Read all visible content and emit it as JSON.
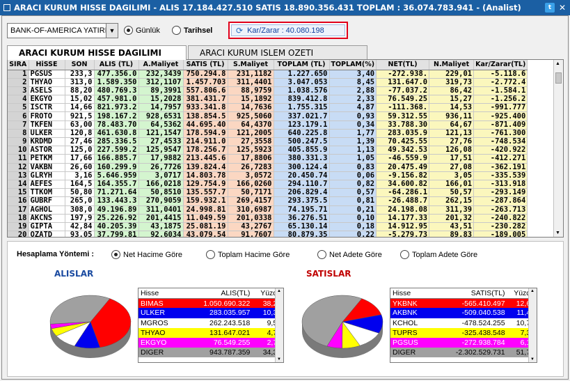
{
  "window": {
    "title": "ARACI KURUM HISSE DAGILIMI - ALIS 17.184.427.510  SATIS 18.890.356.431  TOPLAM : 36.074.783.941 - (Analist)"
  },
  "toolbar": {
    "broker": "BANK-OF-AMERICA YATIRIM",
    "radio_gunluk": "Günlük",
    "radio_tarihsel": "Tarihsel",
    "karzarar": "Kar/Zarar : 40.080.198"
  },
  "tabs": [
    "ARACI KURUM HISSE DAGILIMI",
    "ARACI KURUM ISLEM OZETI"
  ],
  "grid": {
    "headers": [
      "SIRA",
      "HiSSE",
      "SON",
      "ALIS (TL)",
      "A.Maliyet",
      "SATIS (TL)",
      "S.Maliyet",
      "TOPLAM (TL)",
      "TOPLAM(%)",
      "NET(TL)",
      "N.Maliyet",
      "Kar/Zarar(TL)"
    ],
    "rows": [
      [
        "1",
        "PGSUS",
        "233,3",
        "477.356.0",
        "232,3439",
        "750.294.8",
        "231,1182",
        "1.227.650",
        "3,40",
        "-272.938.",
        "229,01",
        "-5.118.6"
      ],
      [
        "2",
        "THYAO",
        "313,0",
        "1.589.350",
        "312,1107",
        "1.457.703",
        "311,4401",
        "3.047.053",
        "8,45",
        "131.647.0",
        "319,73",
        "-2.772.4"
      ],
      [
        "3",
        "ASELS",
        "88,20",
        "480.769.3",
        "89,3991",
        "557.806.6",
        "88,9759",
        "1.038.576",
        "2,88",
        "-77.037.2",
        "86,42",
        "-1.584.1"
      ],
      [
        "4",
        "EKGYO",
        "15,02",
        "457.981.0",
        "15,2028",
        "381.431.7",
        "15,1892",
        "839.412.8",
        "2,33",
        "76.549.25",
        "15,27",
        "-1.256.2"
      ],
      [
        "5",
        "ISCTR",
        "14,66",
        "821.973.2",
        "14,7957",
        "933.341.8",
        "14,7636",
        "1.755.315",
        "4,87",
        "-111.368.",
        "14,53",
        "-991.777"
      ],
      [
        "6",
        "FROTO",
        "921,5",
        "198.167.2",
        "928,6531",
        "138.854.5",
        "925,5060",
        "337.021.7",
        "0,93",
        "59.312.55",
        "936,11",
        "-925.400"
      ],
      [
        "7",
        "TKFEN",
        "63,00",
        "78.483.70",
        "64,5362",
        "44.695.40",
        "64,4370",
        "123.179.1",
        "0,34",
        "33.788.30",
        "64,67",
        "-871.409"
      ],
      [
        "8",
        "ULKER",
        "120,8",
        "461.630.8",
        "121,1547",
        "178.594.9",
        "121,2005",
        "640.225.8",
        "1,77",
        "283.035.9",
        "121,13",
        "-761.300"
      ],
      [
        "9",
        "KRDMD",
        "27,46",
        "285.336.5",
        "27,4533",
        "214.911.0",
        "27,3558",
        "500.247.5",
        "1,39",
        "70.425.55",
        "27,76",
        "-748.534"
      ],
      [
        "10",
        "ASTOR",
        "125,0",
        "227.599.2",
        "125,9547",
        "178.256.7",
        "125,5923",
        "405.855.9",
        "1,13",
        "49.342.53",
        "126,08",
        "-420.922"
      ],
      [
        "11",
        "PETKM",
        "17,66",
        "166.885.7",
        "17,9882",
        "213.445.6",
        "17,8806",
        "380.331.3",
        "1,05",
        "-46.559.9",
        "17,51",
        "-412.271"
      ],
      [
        "12",
        "VAKBN",
        "26,60",
        "160.299.9",
        "26,7726",
        "139.824.4",
        "26,7283",
        "300.124.4",
        "0,83",
        "20.475.49",
        "27,08",
        "-362.191"
      ],
      [
        "13",
        "GLRYH",
        "3,16",
        "5.646.959",
        "3,0717",
        "14.803.78",
        "3,0572",
        "20.450.74",
        "0,06",
        "-9.156.82",
        "3,05",
        "-335.539"
      ],
      [
        "14",
        "AEFES",
        "164,5",
        "164.355.7",
        "166,0218",
        "129.754.9",
        "166,0260",
        "294.110.7",
        "0,82",
        "34.600.82",
        "166,01",
        "-313.918"
      ],
      [
        "15",
        "TTKOM",
        "50,80",
        "71.271.64",
        "50,8510",
        "135.557.7",
        "50,7171",
        "206.829.4",
        "0,57",
        "-64.286.1",
        "50,57",
        "-293.149"
      ],
      [
        "16",
        "GUBRF",
        "265,0",
        "133.443.3",
        "270,9059",
        "159.932.1",
        "269,4157",
        "293.375.5",
        "0,81",
        "-26.488.7",
        "262,15",
        "-287.864"
      ],
      [
        "17",
        "AGHOL",
        "308,0",
        "49.196.89",
        "311,0401",
        "24.998.81",
        "310,6987",
        "74.195.71",
        "0,21",
        "24.198.08",
        "311,39",
        "-263.713"
      ],
      [
        "18",
        "AKCNS",
        "197,9",
        "25.226.92",
        "201,4415",
        "11.049.59",
        "201,0338",
        "36.276.51",
        "0,10",
        "14.177.33",
        "201,32",
        "-240.822"
      ],
      [
        "19",
        "GIPTA",
        "42,84",
        "40.205.39",
        "43,1875",
        "25.081.19",
        "43,2767",
        "65.130.14",
        "0,18",
        "14.912.95",
        "43,51",
        "-230.282"
      ],
      [
        "20",
        "OZATD",
        "93,05",
        "37.799.81",
        "92,6034",
        "43.079.54",
        "91,7607",
        "80.879.35",
        "0,22",
        "-5.279.73",
        "89,83",
        "-189.005"
      ]
    ]
  },
  "hesaplama": {
    "label": "Hesaplama Yöntemi :",
    "options": [
      "Net Hacime Göre",
      "Toplam Hacime Göre",
      "Net Adete Göre",
      "Toplam Adete Göre"
    ]
  },
  "alislar": {
    "title": "ALISLAR",
    "headers": [
      "Hisse",
      "ALIS(TL)",
      "Yüzde"
    ],
    "rows": [
      {
        "name": "BIMAS",
        "value": "1.050.690.322",
        "pct": "38,24",
        "pct_num": 38.24,
        "bg": "#ff0000",
        "fg": "#ffffff"
      },
      {
        "name": "ULKER",
        "value": "283.035.957",
        "pct": "10,30",
        "pct_num": 10.3,
        "bg": "#0000ee",
        "fg": "#ffffff"
      },
      {
        "name": "MGROS",
        "value": "262.243.518",
        "pct": "9,54",
        "pct_num": 9.54,
        "bg": "#ffffff",
        "fg": "#000000"
      },
      {
        "name": "THYAO",
        "value": "131.647.021",
        "pct": "4,79",
        "pct_num": 4.79,
        "bg": "#ffff00",
        "fg": "#000000"
      },
      {
        "name": "EKGYO",
        "value": "76.549.255",
        "pct": "2,79",
        "pct_num": 2.79,
        "bg": "#ff00ff",
        "fg": "#ffffff"
      },
      {
        "name": "DIGER",
        "value": "943.787.359",
        "pct": "34,35",
        "pct_num": 34.35,
        "bg": "#a0a0a0",
        "fg": "#000000"
      }
    ]
  },
  "satislar": {
    "title": "SATISLAR",
    "headers": [
      "Hisse",
      "SATIS(TL)",
      "Yüzde"
    ],
    "rows": [
      {
        "name": "YKBNK",
        "value": "-565.410.497",
        "pct": "12,69",
        "pct_num": 12.69,
        "bg": "#ff0000",
        "fg": "#ffffff"
      },
      {
        "name": "AKBNK",
        "value": "-509.040.538",
        "pct": "11,43",
        "pct_num": 11.43,
        "bg": "#0000ee",
        "fg": "#ffffff"
      },
      {
        "name": "KCHOL",
        "value": "-478.524.255",
        "pct": "10,74",
        "pct_num": 10.74,
        "bg": "#ffffff",
        "fg": "#000000"
      },
      {
        "name": "TUPRS",
        "value": "-325.438.548",
        "pct": "7,31",
        "pct_num": 7.31,
        "bg": "#ffff00",
        "fg": "#000000"
      },
      {
        "name": "PGSUS",
        "value": "-272.938.784",
        "pct": "6,13",
        "pct_num": 6.13,
        "bg": "#ff00ff",
        "fg": "#ffffff"
      },
      {
        "name": "DIGER",
        "value": "-2.302.529.731",
        "pct": "51,70",
        "pct_num": 51.7,
        "bg": "#a0a0a0",
        "fg": "#000000"
      }
    ]
  }
}
